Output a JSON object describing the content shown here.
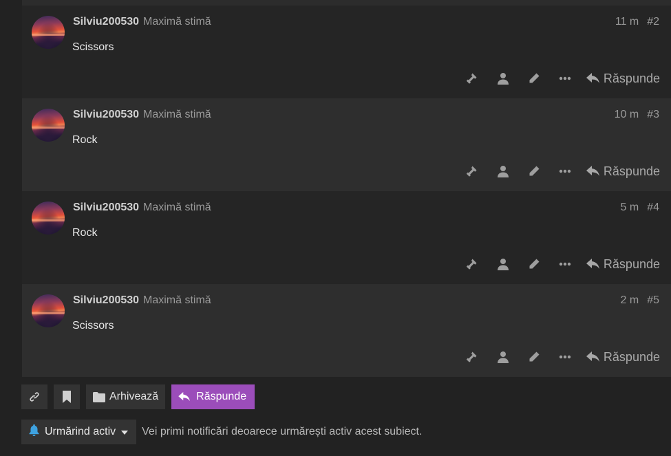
{
  "posts": [
    {
      "username": "Silviu200530",
      "user_title": "Maximă stimă",
      "time": "11 m",
      "number": "#2",
      "content": "Scissors"
    },
    {
      "username": "Silviu200530",
      "user_title": "Maximă stimă",
      "time": "10 m",
      "number": "#3",
      "content": "Rock"
    },
    {
      "username": "Silviu200530",
      "user_title": "Maximă stimă",
      "time": "5 m",
      "number": "#4",
      "content": "Rock"
    },
    {
      "username": "Silviu200530",
      "user_title": "Maximă stimă",
      "time": "2 m",
      "number": "#5",
      "content": "Scissors"
    }
  ],
  "post_actions": {
    "icons": [
      "gavel-icon",
      "user-icon",
      "pencil-icon",
      "ellipsis-icon"
    ],
    "reply_label": "Răspunde"
  },
  "topic_footer": {
    "archive_label": "Arhivează",
    "reply_label": "Răspunde"
  },
  "notifications": {
    "level_label": "Urmărind activ",
    "description": "Vei primi notificări deoarece urmărești activ acest subiect."
  },
  "colors": {
    "background": "#222222",
    "accent": "#9b4dba",
    "bell": "#3ea2e0"
  }
}
